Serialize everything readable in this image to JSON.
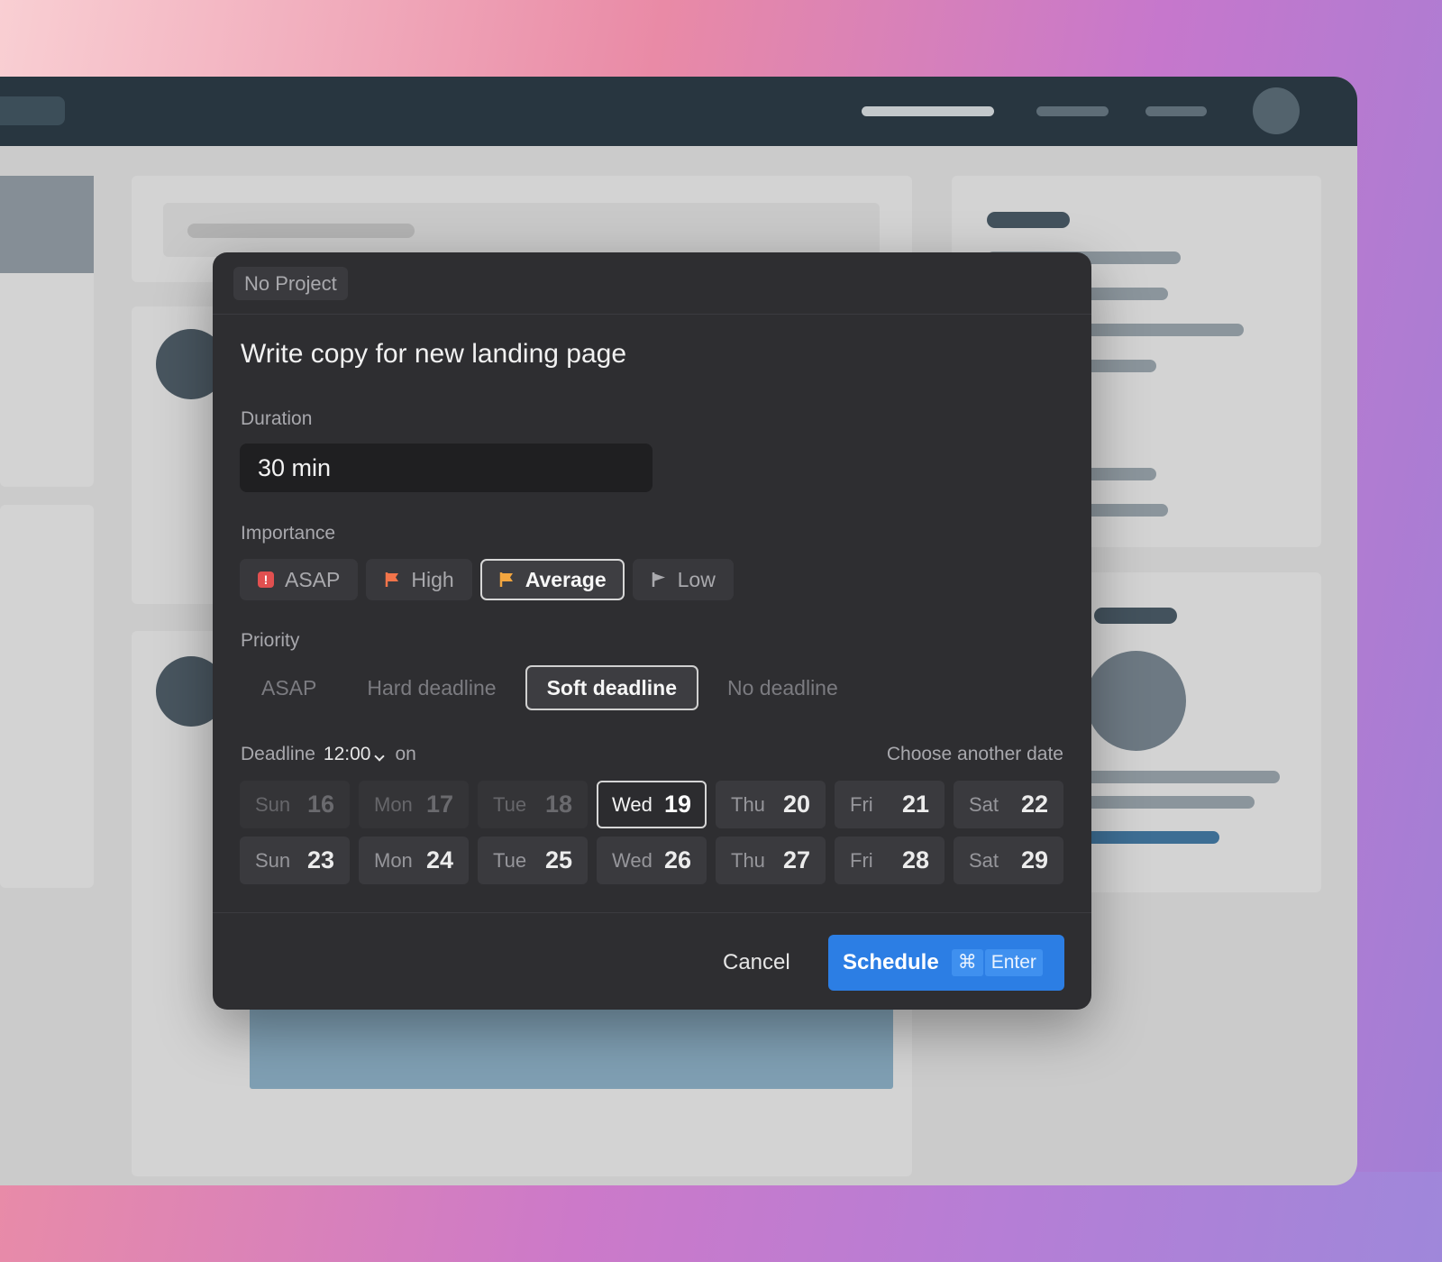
{
  "modal": {
    "project": "No Project",
    "title": "Write copy for new landing page",
    "duration": {
      "label": "Duration",
      "value": "30 min"
    },
    "importance": {
      "label": "Importance",
      "options": [
        {
          "label": "ASAP",
          "icon": "alert-square-icon",
          "color": "#e15050",
          "selected": false
        },
        {
          "label": "High",
          "icon": "flag-icon",
          "color": "#f2744a",
          "selected": false
        },
        {
          "label": "Average",
          "icon": "flag-icon",
          "color": "#f3a63f",
          "selected": true
        },
        {
          "label": "Low",
          "icon": "flag-icon",
          "color": "#a9a9ad",
          "selected": false
        }
      ]
    },
    "priority": {
      "label": "Priority",
      "options": [
        {
          "label": "ASAP",
          "selected": false
        },
        {
          "label": "Hard deadline",
          "selected": false
        },
        {
          "label": "Soft deadline",
          "selected": true
        },
        {
          "label": "No deadline",
          "selected": false
        }
      ]
    },
    "deadline": {
      "label": "Deadline",
      "time": "12:00",
      "on": "on",
      "choose_another": "Choose another date"
    },
    "calendar": [
      {
        "dow": "Sun",
        "num": "16",
        "state": "past"
      },
      {
        "dow": "Mon",
        "num": "17",
        "state": "past"
      },
      {
        "dow": "Tue",
        "num": "18",
        "state": "past"
      },
      {
        "dow": "Wed",
        "num": "19",
        "state": "selected"
      },
      {
        "dow": "Thu",
        "num": "20",
        "state": "normal"
      },
      {
        "dow": "Fri",
        "num": "21",
        "state": "normal"
      },
      {
        "dow": "Sat",
        "num": "22",
        "state": "normal"
      },
      {
        "dow": "Sun",
        "num": "23",
        "state": "normal"
      },
      {
        "dow": "Mon",
        "num": "24",
        "state": "normal"
      },
      {
        "dow": "Tue",
        "num": "25",
        "state": "normal"
      },
      {
        "dow": "Wed",
        "num": "26",
        "state": "normal"
      },
      {
        "dow": "Thu",
        "num": "27",
        "state": "normal"
      },
      {
        "dow": "Fri",
        "num": "28",
        "state": "normal"
      },
      {
        "dow": "Sat",
        "num": "29",
        "state": "normal"
      }
    ],
    "footer": {
      "cancel": "Cancel",
      "schedule": "Schedule",
      "shortcut_cmd": "⌘",
      "shortcut_key": "Enter"
    }
  },
  "colors": {
    "accent": "#2c7ee4",
    "modal_bg": "#2e2e31"
  }
}
